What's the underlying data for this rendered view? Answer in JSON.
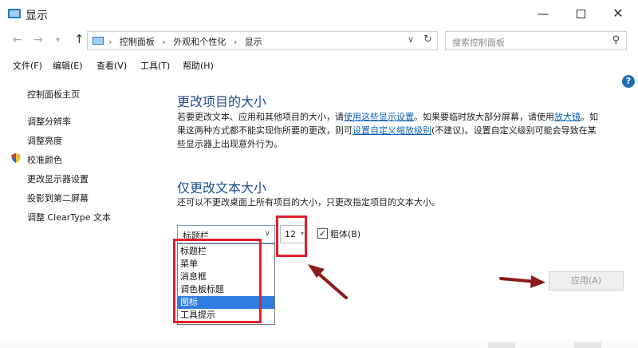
{
  "window": {
    "title": "显示",
    "minimize_glyph": "—",
    "close_glyph": "✕"
  },
  "address": {
    "crumbs": [
      "控制面板",
      "外观和个性化",
      "显示"
    ],
    "search_placeholder": "搜索控制面板"
  },
  "menu": [
    "文件(F)",
    "编辑(E)",
    "查看(V)",
    "工具(T)",
    "帮助(H)"
  ],
  "sidebar": {
    "items": [
      "控制面板主页",
      "调整分辨率",
      "调整亮度",
      "校准颜色",
      "更改显示器设置",
      "投影到第二屏幕",
      "调整 ClearType 文本"
    ]
  },
  "section1": {
    "heading": "更改项目的大小",
    "line1_a": "若要更改文本、应用和其他项目的大小，请",
    "line1_link": "使用这些显示设置",
    "line1_b": "。如果要临时放大部分屏幕，请使用",
    "line1_link2": "放大镜",
    "line1_c": "。如",
    "line2_a": "果这两种方式都不能实现你所要的更改，则可",
    "line2_link": "设置自定义缩放级别",
    "line2_b": "(不建议)。设置自定义级别可能会导致在某",
    "line3": "些显示器上出现意外行为。"
  },
  "section2": {
    "heading": "仅更改文本大小",
    "description": "还可以不更改桌面上所有项目的大小，只更改指定项目的文本大小。"
  },
  "controls": {
    "item_select_value": "标题栏",
    "size_value": "12",
    "bold_checked": true,
    "bold_check_glyph": "✓",
    "bold_label": "粗体(B)",
    "apply_label": "应用(A)"
  },
  "dropdown": {
    "options": [
      "标题栏",
      "菜单",
      "消息框",
      "调色板标题",
      "图标",
      "工具提示"
    ],
    "selected_index": 4
  },
  "colors": {
    "annotation_red": "#e0202b",
    "arrow_dark_red": "#8b1a1a",
    "link_blue": "#0b5fb3",
    "heading_blue": "#1c4f8f",
    "selection_blue": "#2f7de1"
  }
}
